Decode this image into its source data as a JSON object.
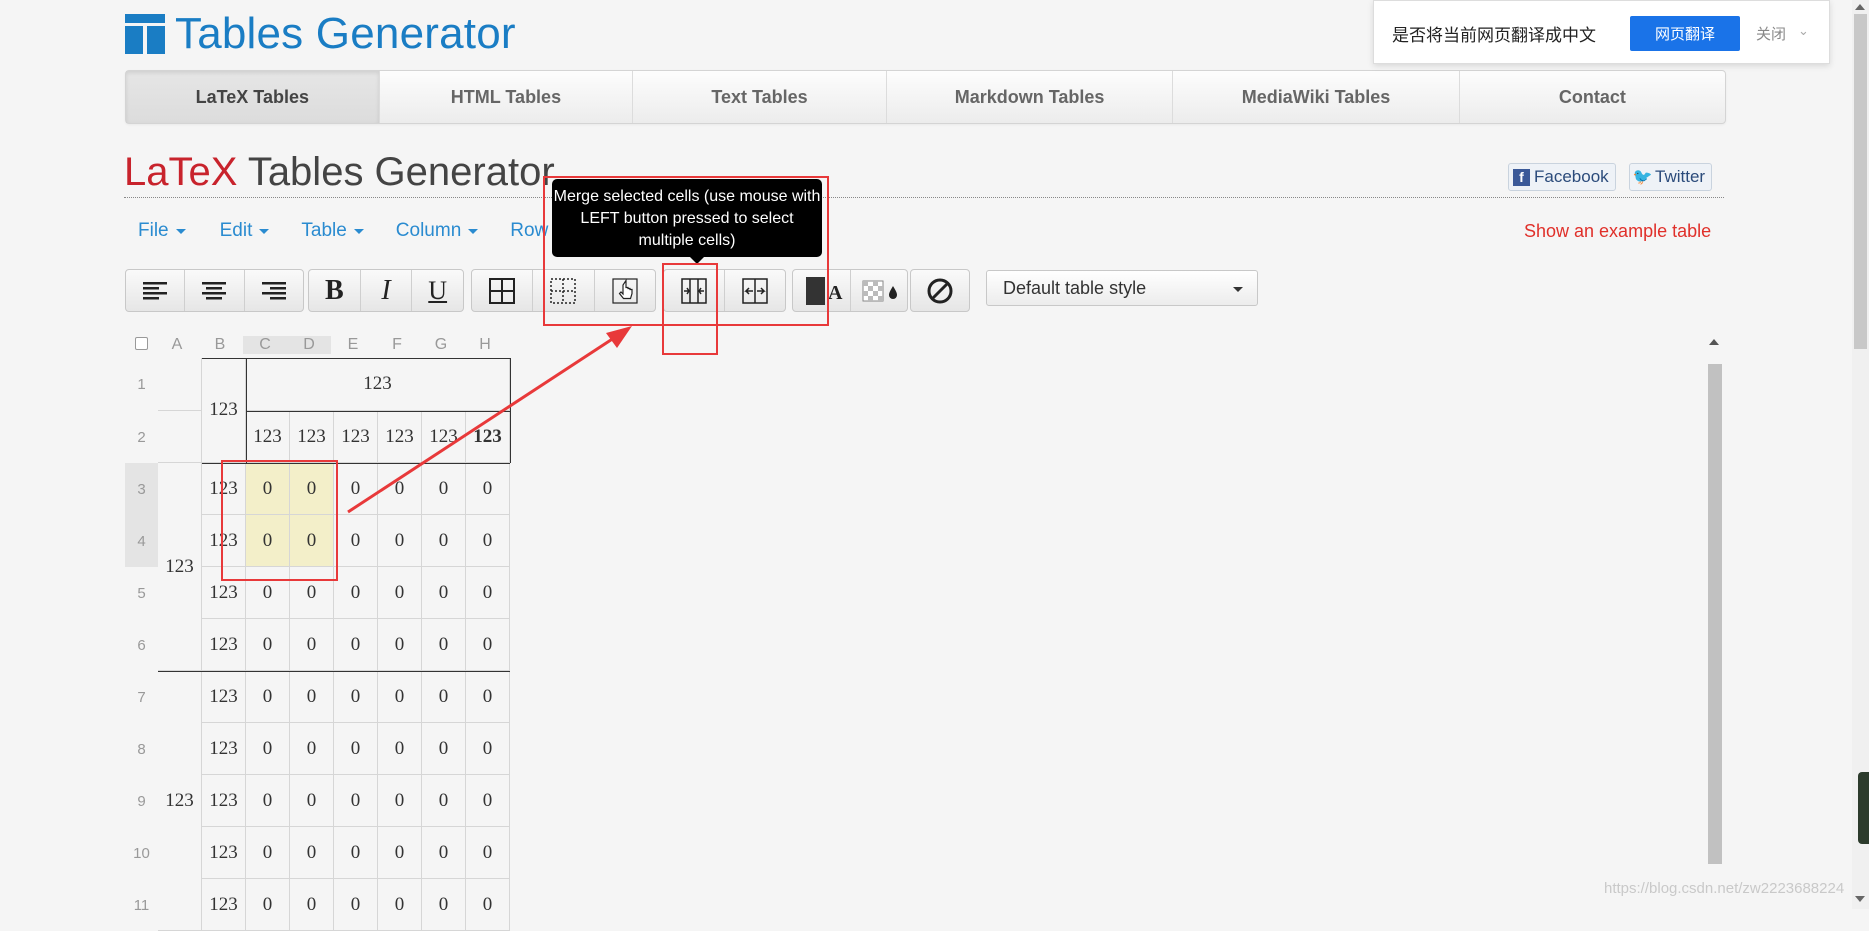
{
  "app": {
    "logo_text": "Tables Generator",
    "title_red": "LaTeX",
    "title_rest": " Tables Generator"
  },
  "nav": {
    "tabs": [
      {
        "label": "LaTeX Tables",
        "active": true
      },
      {
        "label": "HTML Tables"
      },
      {
        "label": "Text Tables"
      },
      {
        "label": "Markdown Tables"
      },
      {
        "label": "MediaWiki Tables"
      },
      {
        "label": "Contact"
      }
    ]
  },
  "social": {
    "facebook": "Facebook",
    "twitter": "Twitter"
  },
  "menus": [
    "File",
    "Edit",
    "Table",
    "Column",
    "Row"
  ],
  "example_link": "Show an example table",
  "toolbar": {
    "style_select": "Default table style",
    "icons": [
      "align-left-icon",
      "align-center-icon",
      "align-right-icon",
      "bold-icon",
      "italic-icon",
      "underline-icon",
      "all-borders-icon",
      "border-style-icon",
      "select-hand-icon",
      "merge-cells-icon",
      "split-cells-icon",
      "text-color-icon",
      "background-color-icon",
      "clear-format-icon"
    ]
  },
  "tooltip": "Merge selected cells (use mouse with LEFT button pressed to select multiple cells)",
  "grid": {
    "column_headers": [
      "A",
      "B",
      "C",
      "D",
      "E",
      "F",
      "G",
      "H"
    ],
    "selected_columns": [
      "C",
      "D"
    ],
    "row_headers": [
      "1",
      "2",
      "3",
      "4",
      "5",
      "6",
      "7",
      "8",
      "9",
      "10",
      "11"
    ],
    "selected_rows": [
      "3",
      "4"
    ],
    "merged_cells": [
      {
        "row": 1,
        "col": "B",
        "text": "123",
        "rowspan": 2
      },
      {
        "row": 1,
        "col": "C",
        "text": "123",
        "colspan": 6
      },
      {
        "row": 3,
        "col": "A",
        "text": "123",
        "rowspan": 4
      },
      {
        "row": 7,
        "col": "A",
        "text": "123",
        "rowspan": 5
      }
    ],
    "row2": [
      "123",
      "123",
      "123",
      "123",
      "123",
      "123"
    ],
    "body_b_column": "123",
    "body_value": "0"
  },
  "translate_popup": {
    "text": "是否将当前网页翻译成中文",
    "button": "网页翻译",
    "close": "关闭"
  },
  "watermark": "https://blog.csdn.net/zw2223688224"
}
